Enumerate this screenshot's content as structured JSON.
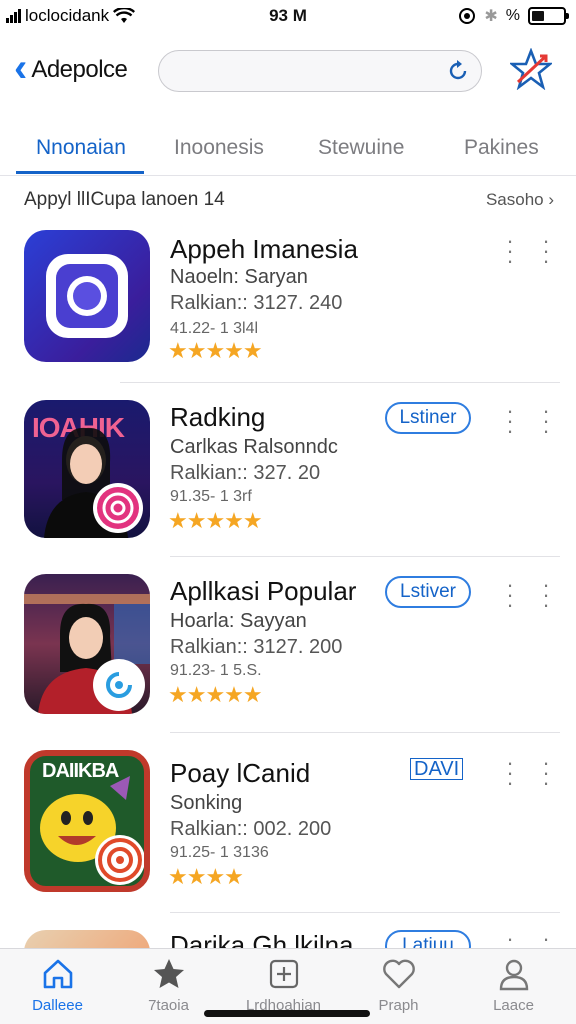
{
  "status_bar": {
    "carrier": "loclocidank",
    "time": "93 M",
    "battery": "%"
  },
  "nav": {
    "back_label": "Adepolce",
    "search_placeholder": ""
  },
  "tabs": [
    {
      "label": "Nnonaian",
      "active": true
    },
    {
      "label": "Inoonesis",
      "active": false
    },
    {
      "label": "Stewuine",
      "active": false
    },
    {
      "label": "Pakines",
      "active": false
    }
  ],
  "section": {
    "title": "Appyl llICupa  lanoen 14",
    "see_all": "Sasoho ›"
  },
  "apps": [
    {
      "name": "Appeh Imanesia",
      "subtitle": "Naoeln: Saryan",
      "rank": "Ralkian:: 3127. 240",
      "meta": "41.22- 1 3l4l",
      "stars": "★★★★★",
      "button": "",
      "icon_text": ""
    },
    {
      "name": "Radking",
      "subtitle": "Carlkas Ralsonndc",
      "rank": "Ralkian:: 327. 20",
      "meta": "91.35- 1 3rf",
      "stars": "★★★★★",
      "button": "Lstiner",
      "icon_text": "IOAHIK"
    },
    {
      "name": "Apllkasi Popular",
      "subtitle": "Hoarla: Sayyan",
      "rank": "Ralkian:: 3127. 200",
      "meta": "91.23- 1 5.S.",
      "stars": "★★★★★",
      "button": "Lstiver",
      "icon_text": ""
    },
    {
      "name": "Poay lCanid",
      "subtitle": "Sonking",
      "rank": "Ralkian:: 002. 200",
      "meta": "91.25- 1 3136",
      "stars": "★★★★",
      "button": "DAVI",
      "icon_text": "DAIIKBA"
    },
    {
      "name": "Darika Gh lkilna",
      "subtitle": "",
      "rank": "",
      "meta": "",
      "stars": "",
      "button": "Latiuu",
      "icon_text": ""
    }
  ],
  "tabbar": [
    {
      "label": "Dalleee",
      "icon": "home-icon",
      "active": true
    },
    {
      "label": "7taoia",
      "icon": "star-icon",
      "active": false
    },
    {
      "label": "Lrdhoahian",
      "icon": "plus-square-icon",
      "active": false
    },
    {
      "label": "Praph",
      "icon": "heart-icon",
      "active": false
    },
    {
      "label": "Laace",
      "icon": "person-icon",
      "active": false
    }
  ],
  "colors": {
    "accent": "#1463c8",
    "star": "#f5a623"
  }
}
